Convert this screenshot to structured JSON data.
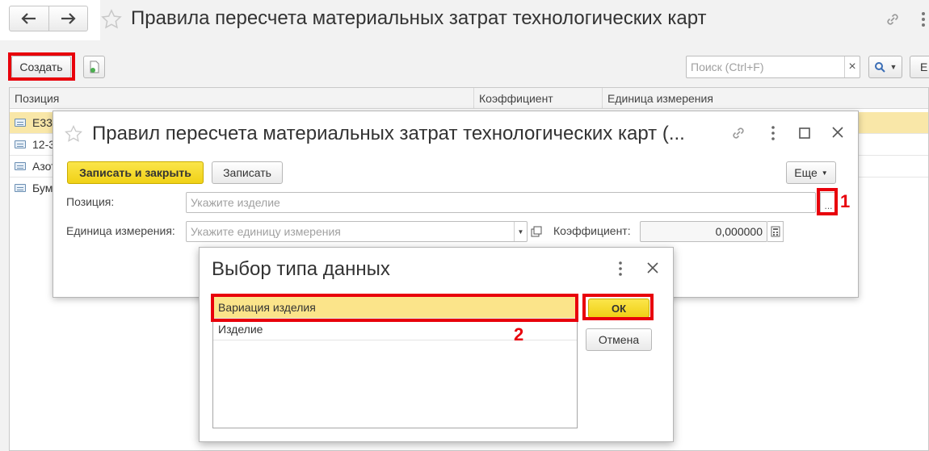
{
  "main": {
    "nav_back_icon": "arrow-left",
    "nav_forward_icon": "arrow-right",
    "title": "Правила пересчета материальных затрат технологических карт",
    "create_button": "Создать",
    "search_placeholder": "Поиск (Ctrl+F)",
    "search_clear": "×",
    "more_partial": "Е",
    "columns": [
      "Позиция",
      "Коэффициент",
      "Единица измерения"
    ],
    "rows": [
      {
        "position": "Е33"
      },
      {
        "position": "12-3"
      },
      {
        "position": "Азот"
      },
      {
        "position": "Бум"
      }
    ]
  },
  "form": {
    "title": "Правил пересчета материальных затрат технологических карт (...",
    "save_close_button": "Записать и закрыть",
    "save_button": "Записать",
    "more_button": "Еще",
    "position_label": "Позиция:",
    "position_placeholder": "Укажите изделие",
    "select_button": "...",
    "unit_label": "Единица измерения:",
    "unit_placeholder": "Укажите единицу измерения",
    "coef_label": "Коэффициент:",
    "coef_value": "0,000000"
  },
  "type_dialog": {
    "title": "Выбор типа данных",
    "items": [
      "Вариация изделия",
      "Изделие"
    ],
    "selected_index": 0,
    "ok_button": "ОК",
    "cancel_button": "Отмена"
  },
  "annotations": {
    "marker_1": "1",
    "marker_2": "2"
  },
  "colors": {
    "accent_yellow": "#f5d92d",
    "selection": "#fbe48a",
    "annotation_red": "#e8000b"
  }
}
